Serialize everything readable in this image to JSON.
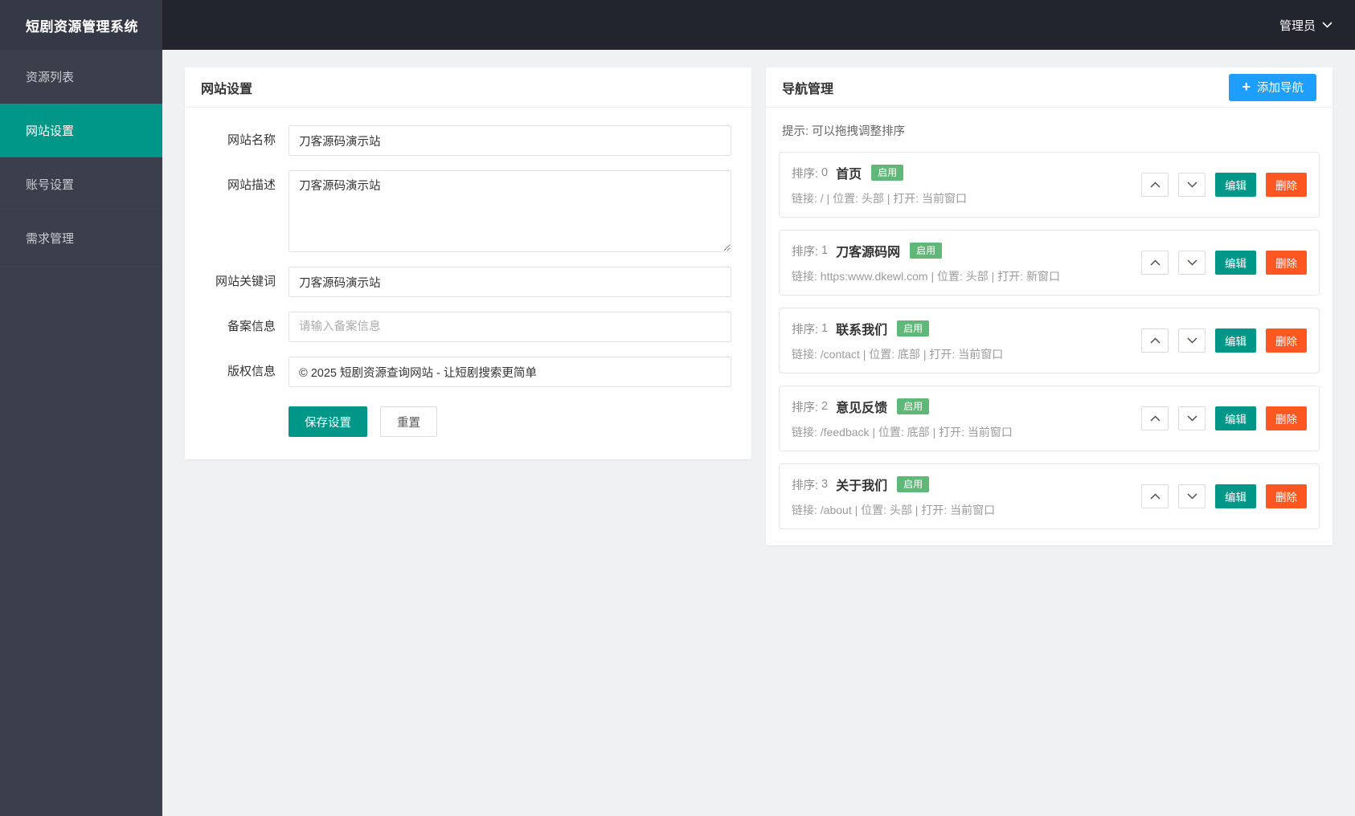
{
  "app": {
    "title": "短剧资源管理系统",
    "user": "管理员"
  },
  "colors": {
    "primary_teal": "#009688",
    "add_button_blue": "#1e9fff",
    "delete_red": "#ff5722",
    "enabled_green": "#5fb878",
    "header_dark": "#22252d",
    "sidebar_dark": "#3a3f4b"
  },
  "sidebar": {
    "items": [
      {
        "label": "资源列表",
        "active": false
      },
      {
        "label": "网站设置",
        "active": true
      },
      {
        "label": "账号设置",
        "active": false
      },
      {
        "label": "需求管理",
        "active": false
      }
    ]
  },
  "site_settings": {
    "card_title": "网站设置",
    "fields": [
      {
        "name": "site-name",
        "label": "网站名称",
        "type": "input",
        "value": "刀客源码演示站"
      },
      {
        "name": "site-desc",
        "label": "网站描述",
        "type": "textarea",
        "value": "刀客源码演示站"
      },
      {
        "name": "site-keywords",
        "label": "网站关键词",
        "type": "input",
        "value": "刀客源码演示站"
      },
      {
        "name": "icp-info",
        "label": "备案信息",
        "type": "input",
        "value": "",
        "placeholder": "请输入备案信息"
      },
      {
        "name": "copyright-info",
        "label": "版权信息",
        "type": "input",
        "value": "© 2025 短剧资源查询网站 - 让短剧搜索更简单"
      }
    ],
    "save_label": "保存设置",
    "reset_label": "重置"
  },
  "nav_manage": {
    "card_title": "导航管理",
    "add_label": "添加导航",
    "hint": "提示: 可以拖拽调整排序",
    "sort_prefix": "排序:",
    "status_enabled": "启用",
    "edit_label": "编辑",
    "delete_label": "删除",
    "items": [
      {
        "sort": "0",
        "name": "首页",
        "meta": "链接: / | 位置: 头部 | 打开: 当前窗口"
      },
      {
        "sort": "1",
        "name": "刀客源码网",
        "meta": "链接: https:www.dkewl.com | 位置: 头部 | 打开: 新窗口"
      },
      {
        "sort": "1",
        "name": "联系我们",
        "meta": "链接: /contact | 位置: 底部 | 打开: 当前窗口"
      },
      {
        "sort": "2",
        "name": "意见反馈",
        "meta": "链接: /feedback | 位置: 底部 | 打开: 当前窗口"
      },
      {
        "sort": "3",
        "name": "关于我们",
        "meta": "链接: /about | 位置: 头部 | 打开: 当前窗口"
      }
    ]
  }
}
